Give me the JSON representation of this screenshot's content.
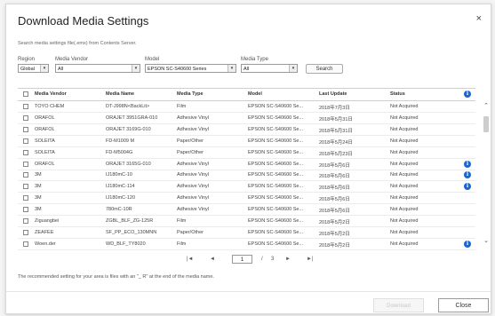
{
  "dialog": {
    "title": "Download Media Settings",
    "close_glyph": "×",
    "description": "Search media settings file(.emx) from Contents Server."
  },
  "filters": {
    "region": {
      "label": "Region",
      "value": "Global"
    },
    "vendor": {
      "label": "Media Vendor",
      "value": "All"
    },
    "model": {
      "label": "Model",
      "value": "EPSON SC-S40600 Series"
    },
    "media_type": {
      "label": "Media Type",
      "value": "All"
    },
    "search_label": "Search"
  },
  "table": {
    "headers": [
      "Media Vendor",
      "Media Name",
      "Media Type",
      "Model",
      "Last Update",
      "Status"
    ],
    "info_icon": "i",
    "rows": [
      {
        "vendor": "TOYO CHEM",
        "name": "DT-J998N<BackLit>",
        "type": "Film",
        "model": "EPSON SC-S40600 Se...",
        "update": "2018年7月3日",
        "status": "Not Acquired",
        "info": false
      },
      {
        "vendor": "ORAFOL",
        "name": "ORAJET 3951GRA-010",
        "type": "Adhesive Vinyl",
        "model": "EPSON SC-S40600 Se...",
        "update": "2018年5月31日",
        "status": "Not Acquired",
        "info": false
      },
      {
        "vendor": "ORAFOL",
        "name": "ORAJET 3169G-010",
        "type": "Adhesive Vinyl",
        "model": "EPSON SC-S40600 Se...",
        "update": "2018年5月31日",
        "status": "Not Acquired",
        "info": false
      },
      {
        "vendor": "SOLEITA",
        "name": "FD-M1009 M",
        "type": "Paper/Other",
        "model": "EPSON SC-S40600 Se...",
        "update": "2018年5月24日",
        "status": "Not Acquired",
        "info": false
      },
      {
        "vendor": "SOLEITA",
        "name": "FD-M5004G",
        "type": "Paper/Other",
        "model": "EPSON SC-S40600 Se...",
        "update": "2018年5月23日",
        "status": "Not Acquired",
        "info": false
      },
      {
        "vendor": "ORAFOL",
        "name": "ORAJET 3165G-010",
        "type": "Adhesive Vinyl",
        "model": "EPSON SC-S40600 Se...",
        "update": "2018年5月6日",
        "status": "Not Acquired",
        "info": true
      },
      {
        "vendor": "3M",
        "name": "IJ180mC-10",
        "type": "Adhesive Vinyl",
        "model": "EPSON SC-S40600 Se...",
        "update": "2018年5月6日",
        "status": "Not Acquired",
        "info": true
      },
      {
        "vendor": "3M",
        "name": "IJ180mC-114",
        "type": "Adhesive Vinyl",
        "model": "EPSON SC-S40600 Se...",
        "update": "2018年5月6日",
        "status": "Not Acquired",
        "info": true
      },
      {
        "vendor": "3M",
        "name": "IJ180mC-120",
        "type": "Adhesive Vinyl",
        "model": "EPSON SC-S40600 Se...",
        "update": "2018年5月6日",
        "status": "Not Acquired",
        "info": false
      },
      {
        "vendor": "3M",
        "name": "780mC-10R",
        "type": "Adhesive Vinyl",
        "model": "EPSON SC-S40600 Se...",
        "update": "2018年5月6日",
        "status": "Not Acquired",
        "info": false
      },
      {
        "vendor": "Ziguangbei",
        "name": "ZGBL_BLF_ZG-125R",
        "type": "Film",
        "model": "EPSON SC-S40600 Se...",
        "update": "2018年5月2日",
        "status": "Not Acquired",
        "info": false
      },
      {
        "vendor": "ZEAFEE",
        "name": "SF_PP_ECO_130MNN",
        "type": "Paper/Other",
        "model": "EPSON SC-S40600 Se...",
        "update": "2018年5月2日",
        "status": "Not Acquired",
        "info": false
      },
      {
        "vendor": "Woen.der",
        "name": "WD_BLF_TY8020",
        "type": "Film",
        "model": "EPSON SC-S40600 Se...",
        "update": "2018年5月2日",
        "status": "Not Acquired",
        "info": true
      }
    ]
  },
  "pagination": {
    "first": "|◄",
    "prev": "◄",
    "current": "1",
    "separator": "/",
    "total": "3",
    "next": "►",
    "last": "►|"
  },
  "note": "The recommended setting for your area is files with an \"_ R\" at the end of the media name.",
  "buttons": {
    "download": "Download",
    "close": "Close"
  },
  "colors": {
    "info_blue": "#1a66d0",
    "border": "#cfcfcf"
  }
}
